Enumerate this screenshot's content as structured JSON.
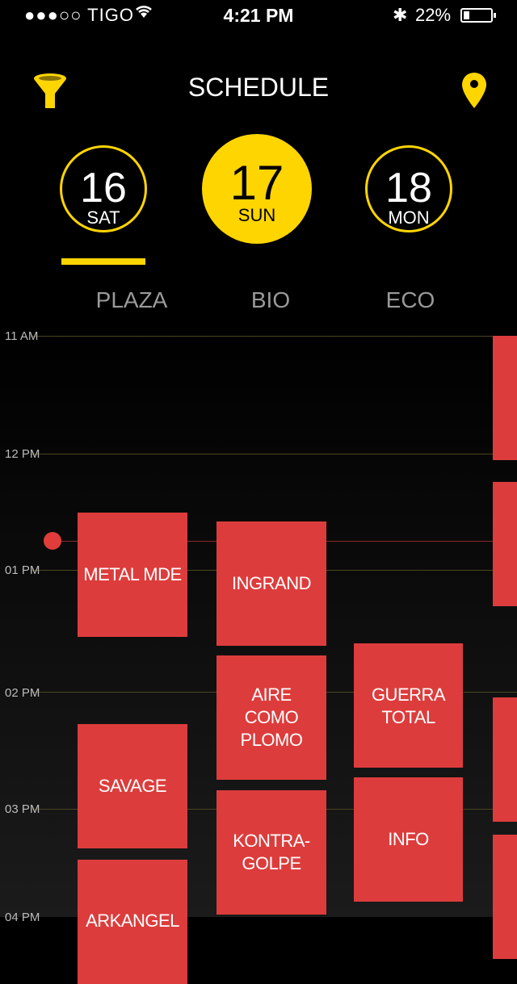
{
  "status_bar": {
    "carrier": "●●●○○ TIGO",
    "time": "4:21 PM",
    "battery": "22%",
    "battery_level": 0.22
  },
  "header": {
    "title": "SCHEDULE",
    "filter_icon": "funnel-icon",
    "location_icon": "map-pin-icon"
  },
  "days": [
    {
      "num": "16",
      "dow": "SAT"
    },
    {
      "num": "17",
      "dow": "SUN"
    },
    {
      "num": "18",
      "dow": "MON"
    }
  ],
  "stages": [
    "PLAZA",
    "BIO",
    "ECO"
  ],
  "timeline": {
    "hours": [
      "11 AM",
      "12 PM",
      "01 PM",
      "02 PM",
      "03 PM",
      "04 PM"
    ]
  },
  "events": [
    {
      "name": "METAL MDE",
      "stage": "PLAZA"
    },
    {
      "name": "SAVAGE",
      "stage": "PLAZA"
    },
    {
      "name": "ARKANGEL",
      "stage": "PLAZA"
    },
    {
      "name": "INGRAND",
      "stage": "BIO"
    },
    {
      "name": "AIRE\nCOMO\nPLOMO",
      "stage": "BIO"
    },
    {
      "name": "KONTRA-\nGOLPE",
      "stage": "BIO"
    },
    {
      "name": "GUERRA\nTOTAL",
      "stage": "ECO"
    },
    {
      "name": "INFO",
      "stage": "ECO"
    }
  ],
  "colors": {
    "accent": "#ffd500",
    "event": "#dd3c3c",
    "background": "#000000"
  }
}
